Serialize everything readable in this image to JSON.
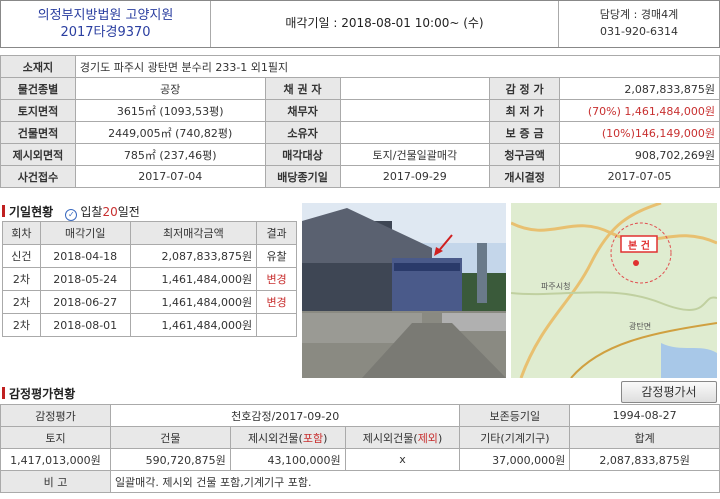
{
  "header": {
    "court_line1": "의정부지방법원 고양지원",
    "court_line2": "2017타경9370",
    "auction_date": "매각기일 : 2018-08-01   10:00~ (수)",
    "contact_line1": "담당계 : 경매4계",
    "contact_line2": "031-920-6314"
  },
  "info": {
    "address_label": "소재지",
    "address": "경기도 파주시 광탄면 분수리 233-1 외1필지",
    "rows": [
      {
        "l1": "물건종별",
        "v1": "공장",
        "l2": "채 권 자",
        "v2": "",
        "l3": "감 정 가",
        "v3": "2,087,833,875원"
      },
      {
        "l1": "토지면적",
        "v1": "3615㎡ (1093,53평)",
        "l2": "채무자",
        "v2": "",
        "l3": "최 저 가",
        "v3": "(70%) 1,461,484,000원"
      },
      {
        "l1": "건물면적",
        "v1": "2449,005㎡ (740,82평)",
        "l2": "소유자",
        "v2": "",
        "l3": "보 증 금",
        "v3": "(10%)146,149,000원"
      },
      {
        "l1": "제시외면적",
        "v1": "785㎡ (237,46평)",
        "l2": "매각대상",
        "v2": "토지/건물일괄매각",
        "l3": "청구금액",
        "v3": "908,702,269원"
      },
      {
        "l1": "사건접수",
        "v1": "2017-07-04",
        "l2": "배당종기일",
        "v2": "2017-09-29",
        "l3": "개시결정",
        "v3": "2017-07-05"
      }
    ]
  },
  "history": {
    "title": "기일현황",
    "bid_note_pre": "입찰",
    "bid_note_days": "20",
    "bid_note_post": "일전",
    "headers": [
      "회차",
      "매각기일",
      "최저매각금액",
      "결과"
    ],
    "rows": [
      {
        "round": "신건",
        "date": "2018-04-18",
        "price": "2,087,833,875원",
        "result": "유찰"
      },
      {
        "round": "2차",
        "date": "2018-05-24",
        "price": "1,461,484,000원",
        "result": "변경"
      },
      {
        "round": "2차",
        "date": "2018-06-27",
        "price": "1,461,484,000원",
        "result": "변경"
      },
      {
        "round": "2차",
        "date": "2018-08-01",
        "price": "1,461,484,000원",
        "result": ""
      }
    ]
  },
  "map": {
    "marker_label": "본 건",
    "place1": "파주시청",
    "place2": "광탄면"
  },
  "appraisal": {
    "title": "감정평가현황",
    "button_label": "감정평가서",
    "row1": {
      "l1": "감정평가",
      "v1": "천호감정/2017-09-20",
      "l2": "보존등기일",
      "v2": "1994-08-27"
    },
    "headers": [
      "토지",
      "건물",
      "제시외건물(",
      "포함",
      ")",
      "제시외건물(",
      "제외",
      ")",
      "기타(기계기구)",
      "합계"
    ],
    "values": [
      "1,417,013,000원",
      "590,720,875원",
      "43,100,000원",
      "x",
      "37,000,000원",
      "2,087,833,875원"
    ],
    "note_label": "비 고",
    "note": "일괄매각. 제시외 건물 포함,기계기구 포함."
  },
  "colors": {
    "accent": "#c83030",
    "court_blue": "#2a3ea0",
    "label_bg": "#e8e8e8"
  }
}
